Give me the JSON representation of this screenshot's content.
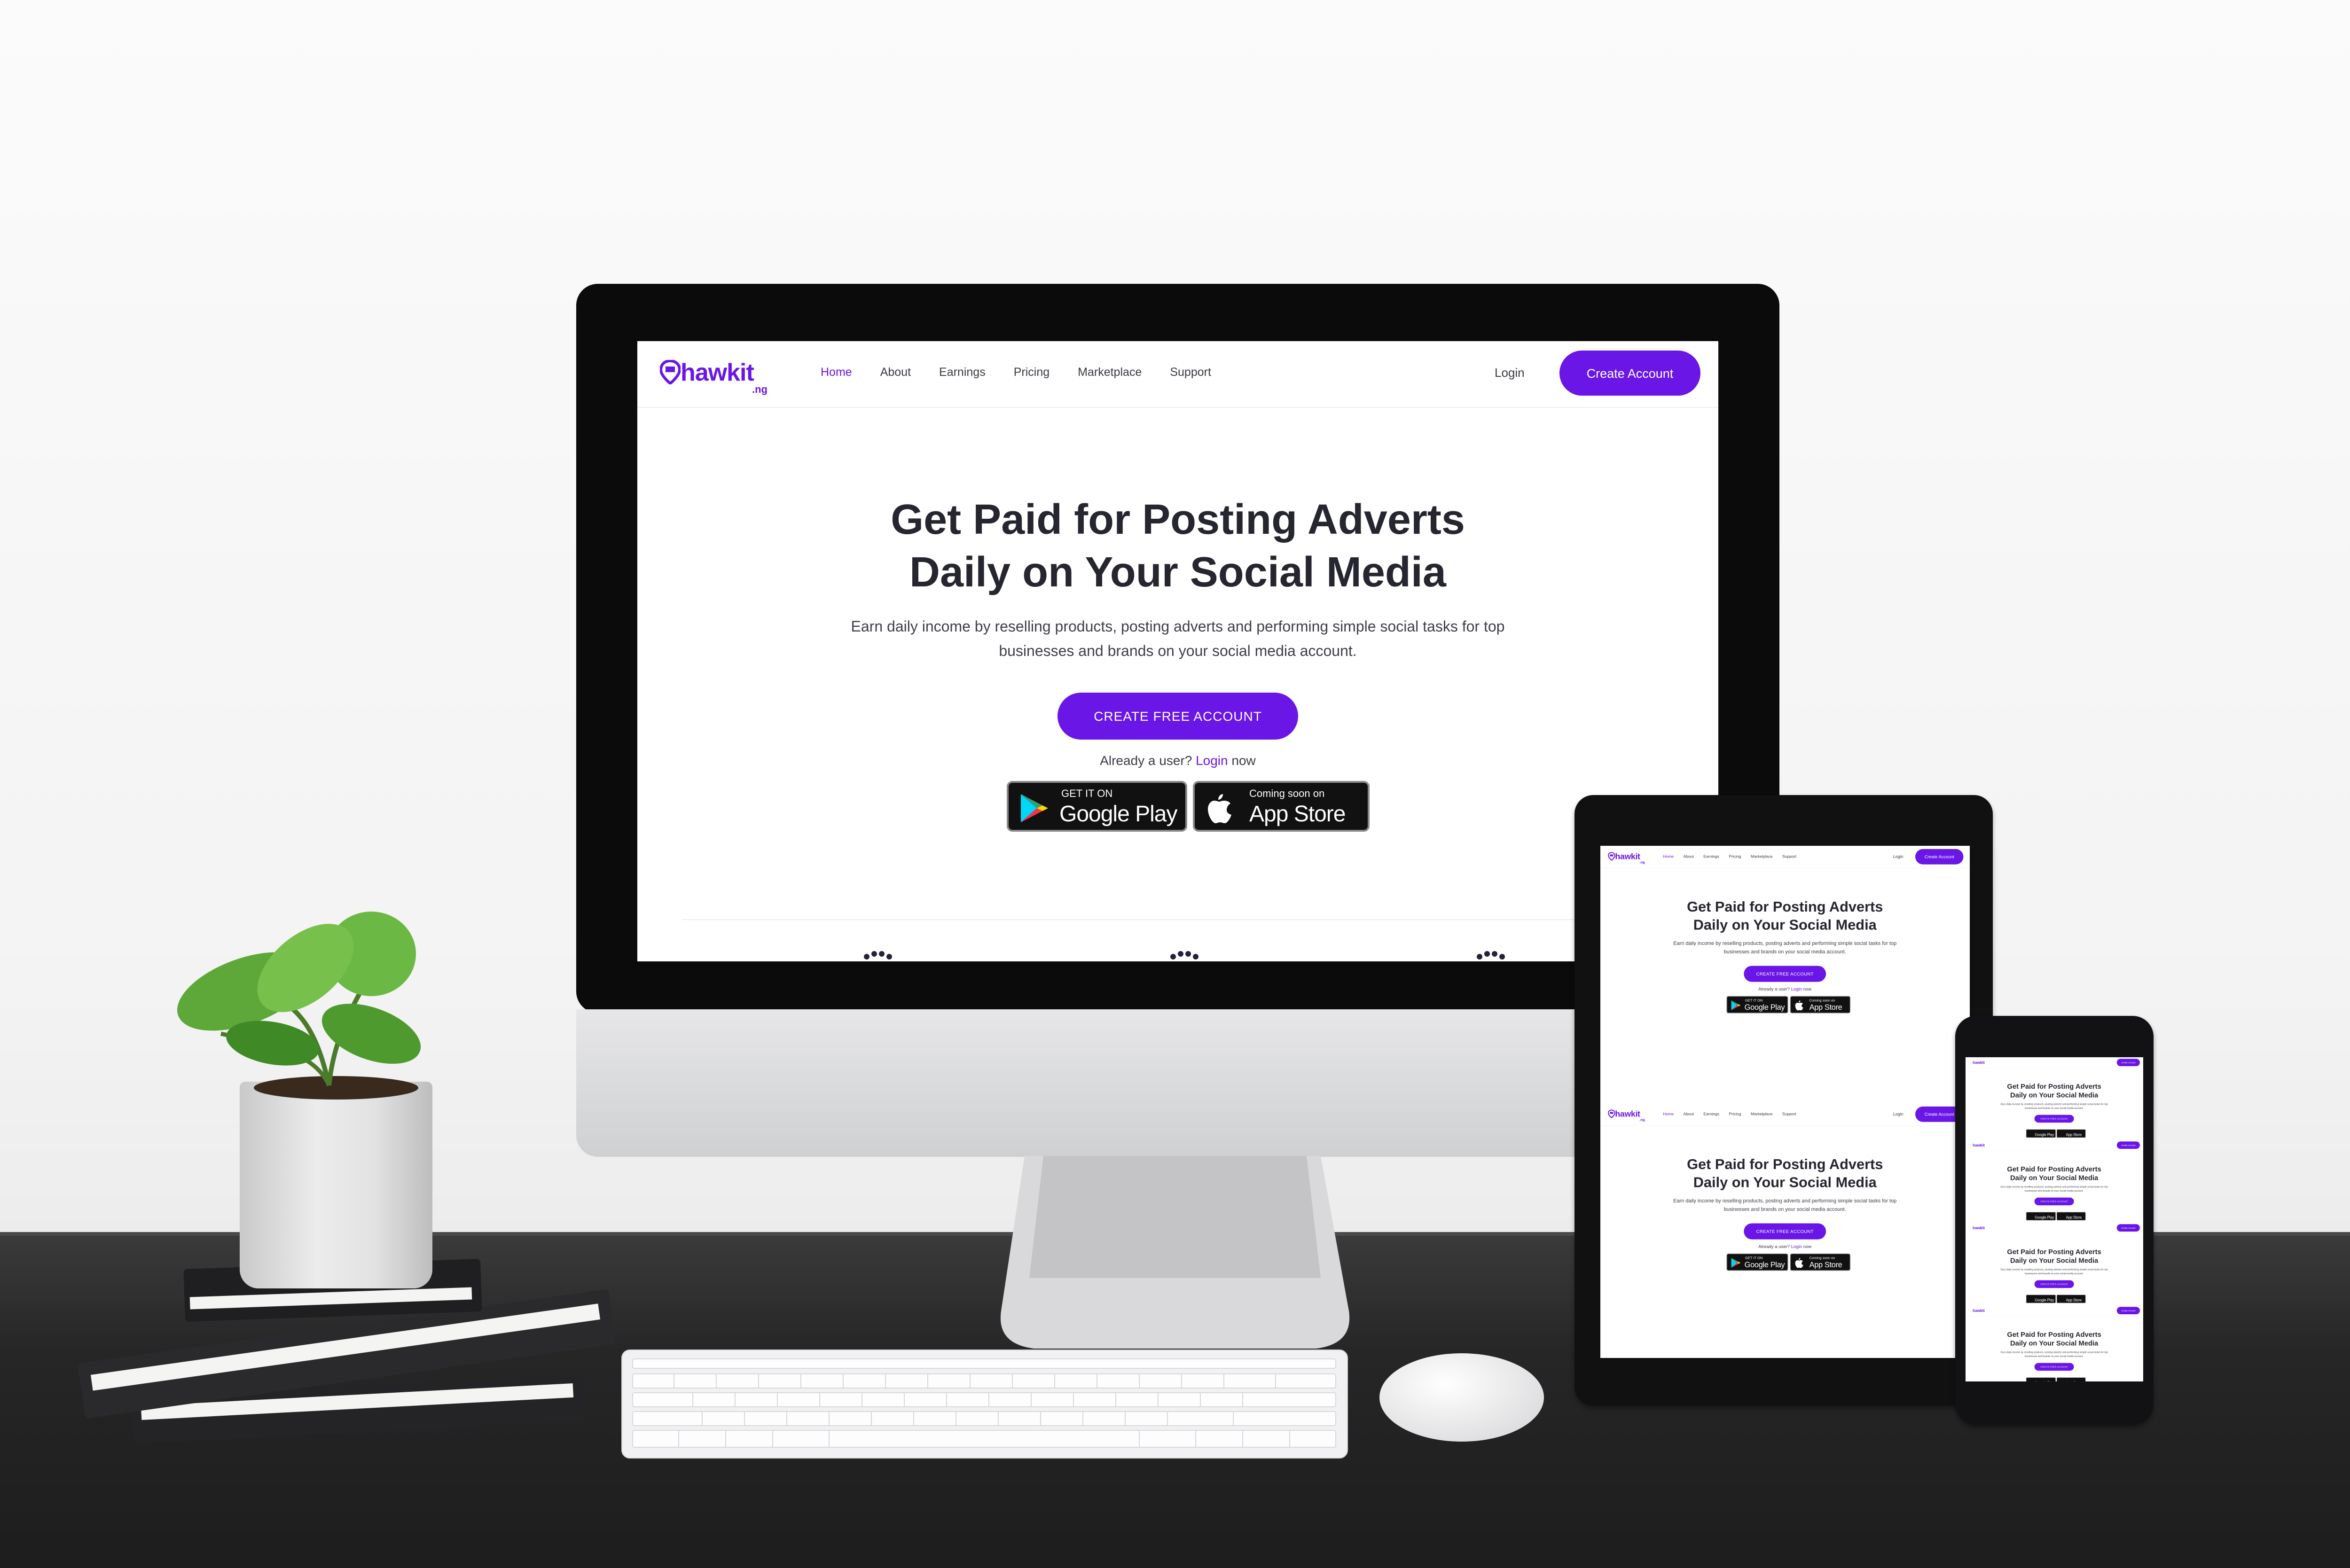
{
  "site": {
    "logo": {
      "word": "hawkit",
      "sub": ".ng"
    },
    "nav": {
      "links": [
        "Home",
        "About",
        "Earnings",
        "Pricing",
        "Marketplace",
        "Support"
      ],
      "active": "Home",
      "login": "Login",
      "cta": "Create Account"
    },
    "hero": {
      "title_line1": "Get Paid for Posting Adverts",
      "title_line2": "Daily on Your Social Media",
      "description": "Earn daily income by reselling products, posting adverts and performing simple social tasks for top businesses and brands on your social media account.",
      "cta": "CREATE FREE ACCOUNT",
      "login_prefix": "Already a user?",
      "login_link": "Login",
      "login_suffix": "now"
    },
    "badges": {
      "google_small": "GET IT ON",
      "google_big": "Google Play",
      "apple_small": "Coming soon on",
      "apple_big": "App Store"
    }
  },
  "colors": {
    "brand": "#6a16e6",
    "text_dark": "#262630",
    "device_black": "#0b0b0c"
  },
  "icons": [
    "hawkit-logo-icon",
    "google-play-icon",
    "apple-icon"
  ]
}
